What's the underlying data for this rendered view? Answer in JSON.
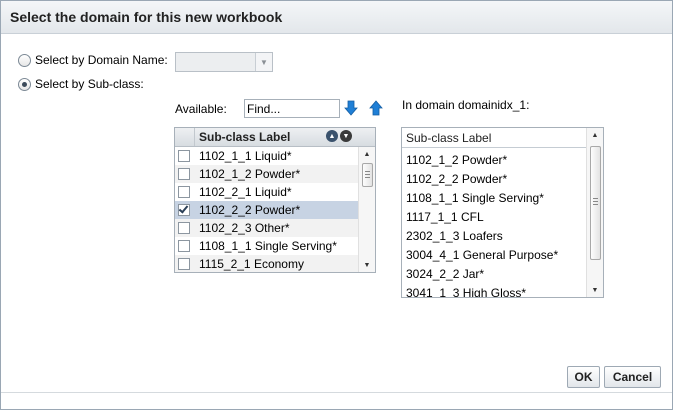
{
  "dialog": {
    "title": "Select the domain for this new workbook"
  },
  "options": {
    "by_domain_name_label": "Select by Domain Name:",
    "by_subclass_label": "Select by Sub-class:",
    "selected": "subclass",
    "domain_name_value": ""
  },
  "available": {
    "label": "Available:",
    "find_placeholder": "Find...",
    "header": "Sub-class Label",
    "items": [
      {
        "label": "1102_1_1 Liquid*",
        "checked": false
      },
      {
        "label": "1102_1_2 Powder*",
        "checked": false
      },
      {
        "label": "1102_2_1 Liquid*",
        "checked": false
      },
      {
        "label": "1102_2_2 Powder*",
        "checked": true
      },
      {
        "label": "1102_2_3 Other*",
        "checked": false
      },
      {
        "label": "1108_1_1 Single Serving*",
        "checked": false
      },
      {
        "label": "1115_2_1 Economy",
        "checked": false
      }
    ]
  },
  "in_domain": {
    "label": "In domain domainidx_1:",
    "header": "Sub-class Label",
    "items": [
      "1102_1_2 Powder*",
      "1102_2_2 Powder*",
      "1108_1_1 Single Serving*",
      "1117_1_1 CFL",
      "2302_1_3 Loafers",
      "3004_4_1 General Purpose*",
      "3024_2_2 Jar*",
      "3041_1_3 High Gloss*"
    ]
  },
  "buttons": {
    "ok_label": "OK",
    "cancel_label": "Cancel"
  },
  "colors": {
    "selected_row": "#c7d3e3",
    "arrow_blue": "#1f7fd6"
  }
}
